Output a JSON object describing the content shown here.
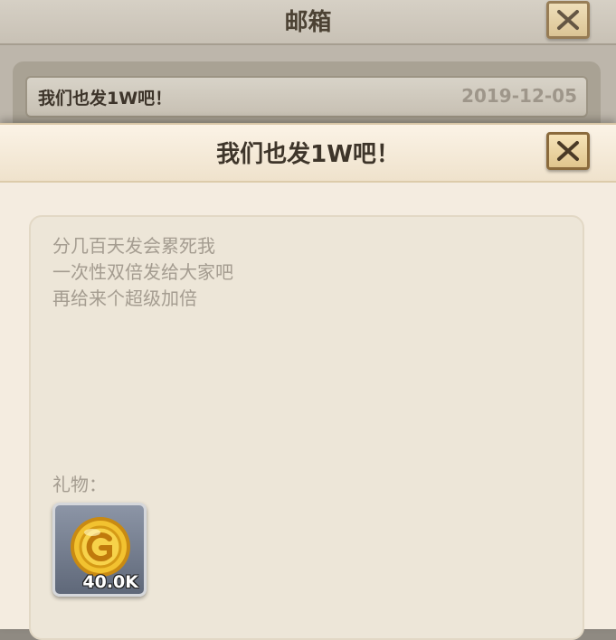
{
  "mailbox": {
    "title": "邮箱",
    "items": [
      {
        "subject": "我们也发1W吧！",
        "date": "2019-12-05"
      }
    ]
  },
  "popup": {
    "title": "我们也发1W吧！",
    "message_lines": [
      "分几百天发会累死我",
      "一次性双倍发给大家吧",
      "再给来个超级加倍"
    ],
    "gift_label": "礼物：",
    "gifts": [
      {
        "icon": "gold-coin-icon",
        "quantity": "40.0K"
      }
    ]
  },
  "colors": {
    "popup_bg": "#f4ece0",
    "text_muted": "#a49c90",
    "title_text": "#3e352a",
    "close_button": "#e0c58d"
  }
}
